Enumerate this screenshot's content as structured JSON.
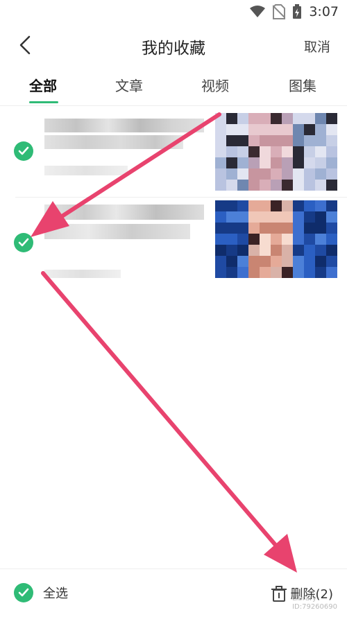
{
  "status_bar": {
    "time": "3:07",
    "icons": [
      "wifi-icon",
      "no-sim-icon",
      "battery-charging-icon"
    ]
  },
  "nav": {
    "back_icon": "chevron-left-icon",
    "title": "我的收藏",
    "cancel_label": "取消"
  },
  "tabs": [
    {
      "label": "全部",
      "active": true
    },
    {
      "label": "文章",
      "active": false
    },
    {
      "label": "视频",
      "active": false
    },
    {
      "label": "图集",
      "active": false
    }
  ],
  "items": [
    {
      "checked": true,
      "content": "blurred"
    },
    {
      "checked": true,
      "content": "blurred"
    }
  ],
  "bottom_bar": {
    "select_all_label": "全选",
    "delete_label": "删除(2)",
    "delete_icon": "trash-icon"
  },
  "watermark": {
    "line1": "Library",
    "line2": "ID:79260690"
  },
  "colors": {
    "accent": "#2fbb76",
    "annotation_arrow": "#e8436e"
  }
}
